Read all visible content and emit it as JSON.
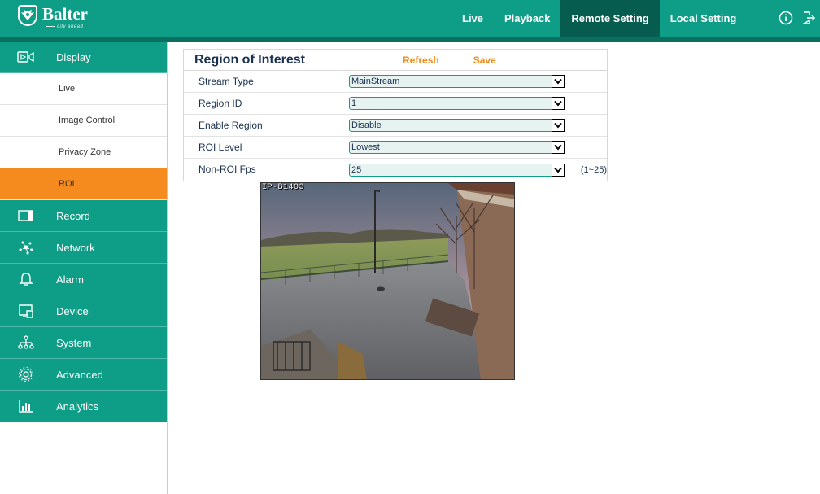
{
  "brand": {
    "name": "Balter",
    "tagline": "city ahead"
  },
  "nav": [
    {
      "label": "Live",
      "active": false
    },
    {
      "label": "Playback",
      "active": false
    },
    {
      "label": "Remote Setting",
      "active": true
    },
    {
      "label": "Local Setting",
      "active": false
    }
  ],
  "header_icons": [
    "info-icon",
    "logout-icon"
  ],
  "sidebar": {
    "display_group": {
      "label": "Display",
      "icon": "display-icon"
    },
    "display_items": [
      {
        "label": "Live",
        "active": false
      },
      {
        "label": "Image Control",
        "active": false
      },
      {
        "label": "Privacy Zone",
        "active": false
      },
      {
        "label": "ROI",
        "active": true
      }
    ],
    "groups": [
      {
        "label": "Record",
        "icon": "record-icon"
      },
      {
        "label": "Network",
        "icon": "network-icon"
      },
      {
        "label": "Alarm",
        "icon": "alarm-icon"
      },
      {
        "label": "Device",
        "icon": "device-icon"
      },
      {
        "label": "System",
        "icon": "system-icon"
      },
      {
        "label": "Advanced",
        "icon": "advanced-icon"
      },
      {
        "label": "Analytics",
        "icon": "analytics-icon"
      }
    ]
  },
  "panel": {
    "title": "Region of Interest",
    "refresh_label": "Refresh",
    "save_label": "Save",
    "rows": [
      {
        "label": "Stream Type",
        "value": "MainStream",
        "suffix": ""
      },
      {
        "label": "Region ID",
        "value": "1",
        "suffix": ""
      },
      {
        "label": "Enable Region",
        "value": "Disable",
        "suffix": ""
      },
      {
        "label": "ROI Level",
        "value": "Lowest",
        "suffix": ""
      },
      {
        "label": "Non-ROI Fps",
        "value": "25",
        "suffix": "(1~25)"
      }
    ]
  },
  "video": {
    "osd_text": "IP-B1403"
  },
  "colors": {
    "primary": "#0e9d86",
    "primary_dark": "#055c4f",
    "accent": "#f58a1f",
    "action": "#f08a1a",
    "text_dark": "#1a3050"
  }
}
